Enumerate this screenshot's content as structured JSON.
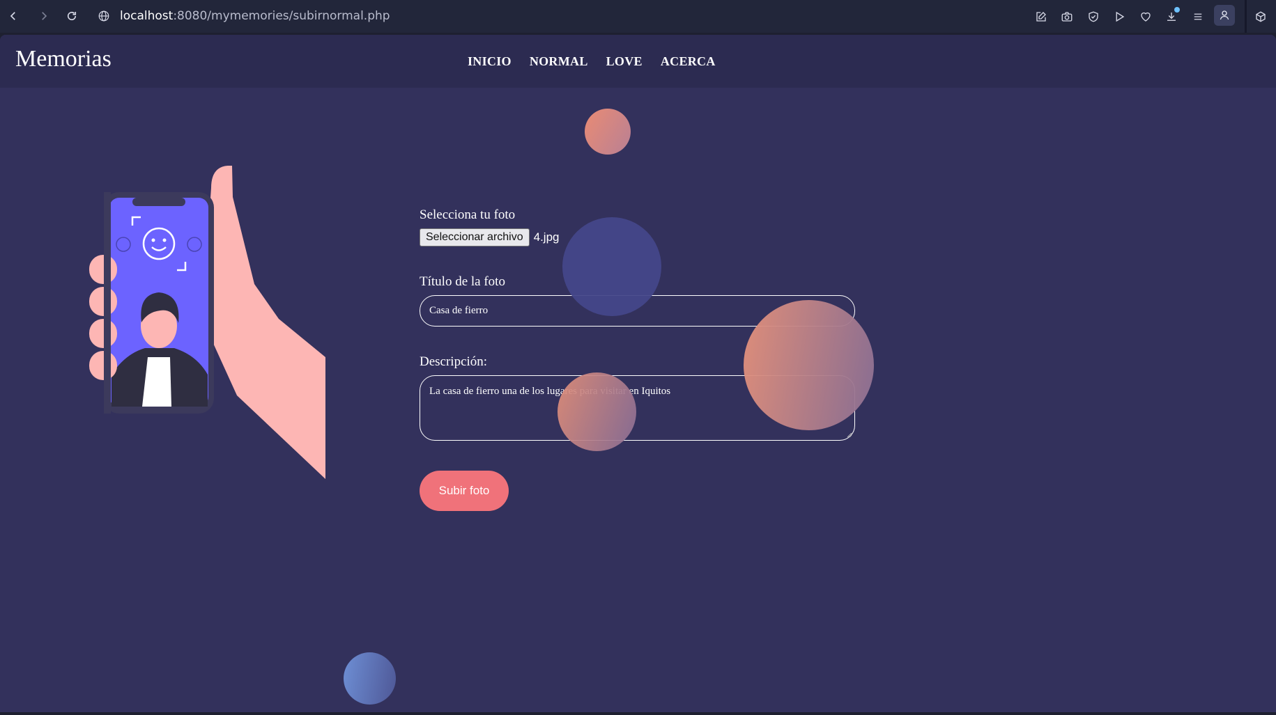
{
  "browser": {
    "url_host": "localhost",
    "url_path": ":8080/mymemories/subirnormal.php",
    "nav_icons": [
      "back-arrow-icon",
      "forward-arrow-icon",
      "reload-icon"
    ],
    "toolbar_icons": [
      "edit-page-icon",
      "camera-icon",
      "shield-icon",
      "play-icon",
      "heart-icon",
      "download-icon",
      "menu-list-icon",
      "profile-icon",
      "extensions-cube-icon"
    ],
    "download_badge_color": "#6ec1ff"
  },
  "site": {
    "logo": "Memorias",
    "nav": [
      "INICIO",
      "NORMAL",
      "LOVE",
      "ACERCA"
    ],
    "background_color": "#33315c",
    "header_color": "#2c2b51"
  },
  "form": {
    "photo_label": "Selecciona tu foto",
    "file_button_label": "Seleccionar archivo",
    "file_name": "4.jpg",
    "title_label": "Título de la foto",
    "title_value": "Casa de fierro",
    "description_label": "Descripción:",
    "description_value": "La casa de fierro una de los lugares para visitar en  Iquitos",
    "submit_label": "Subir foto",
    "submit_color": "#f0727a"
  }
}
